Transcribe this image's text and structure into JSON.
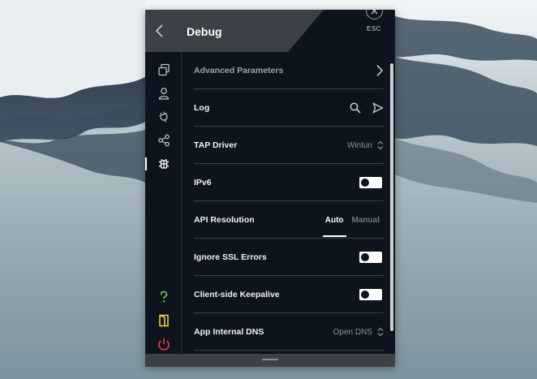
{
  "header": {
    "title": "Debug",
    "esc_label": "ESC"
  },
  "sidebar": {
    "items": [
      {
        "name": "connection",
        "icon": "connection-icon"
      },
      {
        "name": "account",
        "icon": "account-icon"
      },
      {
        "name": "plugins",
        "icon": "plug-icon"
      },
      {
        "name": "share",
        "icon": "share-icon"
      },
      {
        "name": "debug",
        "icon": "bug-icon",
        "active": true
      }
    ],
    "bottom": [
      {
        "name": "help",
        "icon": "help-icon",
        "color": "#6ec04a"
      },
      {
        "name": "exit-door",
        "icon": "door-icon",
        "color": "#f2c94c"
      },
      {
        "name": "power",
        "icon": "power-icon",
        "color": "#e5393b"
      }
    ]
  },
  "settings": {
    "advanced_parameters": {
      "label": "Advanced Parameters"
    },
    "log": {
      "label": "Log"
    },
    "tap_driver": {
      "label": "TAP Driver",
      "value": "Wintun"
    },
    "ipv6": {
      "label": "IPv6",
      "enabled": false
    },
    "api_resolution": {
      "label": "API Resolution",
      "options": [
        "Auto",
        "Manual"
      ],
      "selected": "Auto"
    },
    "ignore_ssl": {
      "label": "Ignore SSL Errors",
      "enabled": false
    },
    "keepalive": {
      "label": "Client-side Keepalive",
      "enabled": false
    },
    "internal_dns": {
      "label": "App Internal DNS",
      "value": "Open DNS"
    }
  },
  "colors": {
    "panel": "#0d141d",
    "header_plate": "#3c4147",
    "divider": "#3a424b",
    "text": "#f0f2f4",
    "muted": "#8d959c"
  }
}
